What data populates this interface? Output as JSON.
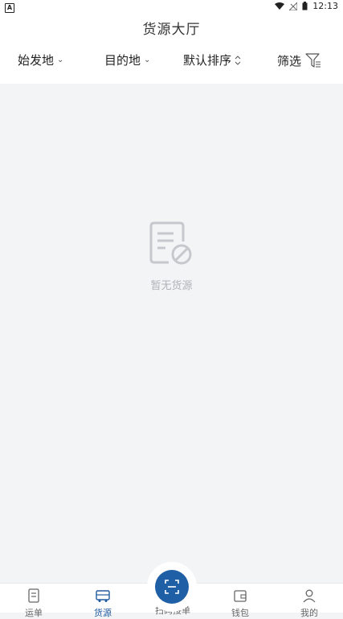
{
  "status_bar": {
    "time": "12:13",
    "app_icon_letter": "A"
  },
  "header": {
    "title": "货源大厅"
  },
  "filters": {
    "origin_label": "始发地",
    "destination_label": "目的地",
    "sort_label": "默认排序",
    "filter_label": "筛选"
  },
  "empty_state": {
    "text": "暂无货源"
  },
  "tabbar": {
    "tabs": [
      {
        "label": "运单",
        "icon": "document-icon",
        "active": false
      },
      {
        "label": "货源",
        "icon": "truck-icon",
        "active": true
      },
      {
        "label": "扫码接单",
        "icon": "scan-icon",
        "active": false
      },
      {
        "label": "钱包",
        "icon": "wallet-icon",
        "active": false
      },
      {
        "label": "我的",
        "icon": "person-icon",
        "active": false
      }
    ]
  },
  "colors": {
    "accent": "#1e5fa5",
    "background": "#f3f4f6",
    "muted_text": "#b0b2b8"
  }
}
